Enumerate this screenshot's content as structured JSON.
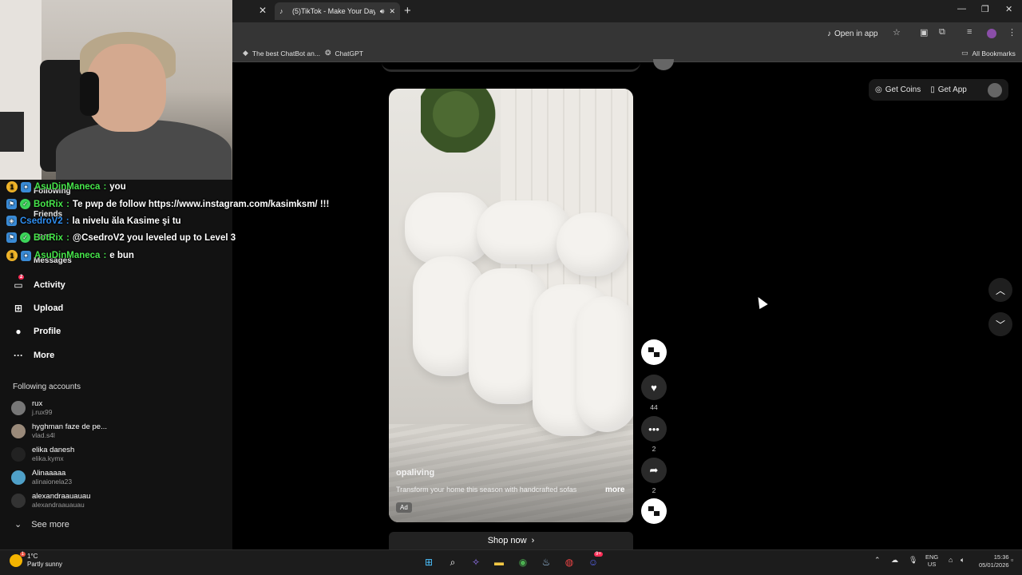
{
  "browser": {
    "prev_tab_close": "✕",
    "active_tab_title": "(5)TikTok - Make Your Day",
    "new_tab": "+",
    "open_in_app": "Open in app",
    "bookmarks": [
      {
        "label": "The best ChatBot an..."
      },
      {
        "label": "ChatGPT"
      }
    ],
    "all_bookmarks": "All Bookmarks",
    "window_controls": [
      "—",
      "❐",
      "✕"
    ]
  },
  "chat": [
    {
      "level": "1",
      "level_color": "#f0b429",
      "user": "AsuDinManeca",
      "user_color": "#47e64b",
      "message": "you"
    },
    {
      "level": "",
      "level_color": "#3a8bd6",
      "user": "BotRix",
      "user_color": "#47e64b",
      "message": "Te pwp de follow https://www.instagram.com/kasimksm/ !!!"
    },
    {
      "level": "",
      "level_color": "#3a8bd6",
      "user": "CsedroV2",
      "user_color": "#2f8ef0",
      "message": "la nivelu ăla Kasime şi tu"
    },
    {
      "level": "",
      "level_color": "#3a8bd6",
      "user": "BotRix",
      "user_color": "#47e64b",
      "message": "@CsedroV2 you leveled up to Level 3"
    },
    {
      "level": "1",
      "level_color": "#f0b429",
      "user": "AsuDinManeca",
      "user_color": "#47e64b",
      "message": "e bun"
    }
  ],
  "sidebar": {
    "hidden_items": [
      "Following",
      "Friends",
      "LIVE",
      "Messages"
    ],
    "items": [
      {
        "label": "Activity",
        "icon": "activity-icon",
        "badge": "2"
      },
      {
        "label": "Upload",
        "icon": "upload-icon"
      },
      {
        "label": "Profile",
        "icon": "profile-icon"
      },
      {
        "label": "More",
        "icon": "more-icon"
      }
    ],
    "following_header": "Following accounts",
    "accounts": [
      {
        "name": "rux",
        "handle": "j.rux99"
      },
      {
        "name": "hyghman faze de pe...",
        "handle": "vlad.s4l"
      },
      {
        "name": "elika danesh",
        "handle": "elika.kymx"
      },
      {
        "name": "Alinaaaaa",
        "handle": "alinaionela23"
      },
      {
        "name": "alexandraauauau",
        "handle": "alexandraauauau"
      }
    ],
    "see_more": "See more"
  },
  "topbar": {
    "get_coins": "Get Coins",
    "get_app": "Get App"
  },
  "video": {
    "username": "opaliving",
    "caption": "Transform your home this season with handcrafted sofas",
    "more": "more",
    "ad_label": "Ad",
    "shop_now": "Shop now"
  },
  "actions": {
    "likes": "44",
    "comments": "2",
    "shares": "2"
  },
  "taskbar": {
    "temperature": "1°C",
    "condition": "Partly sunny",
    "weather_badge": "1",
    "lang_top": "ENG",
    "lang_bottom": "US",
    "time": "15:36",
    "date": "05/01/2026",
    "discord_badge": "9+"
  },
  "colors": {
    "accent": "#fe2c55",
    "chat_green": "#47e64b"
  }
}
